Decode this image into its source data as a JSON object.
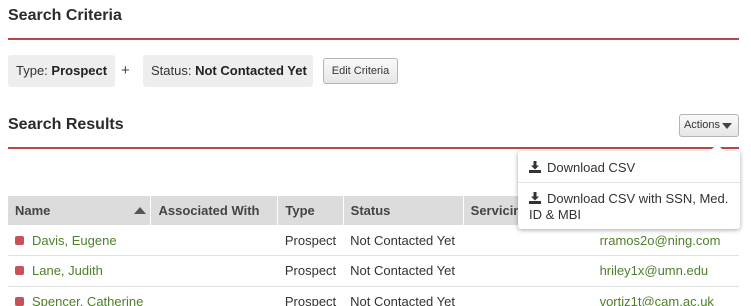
{
  "criteria": {
    "title": "Search Criteria",
    "type_label": "Type:",
    "type_value": "Prospect",
    "plus": "+",
    "status_label": "Status:",
    "status_value": "Not Contacted Yet",
    "edit_button": "Edit Criteria"
  },
  "results": {
    "title": "Search Results",
    "actions_button": "Actions"
  },
  "dropdown": {
    "items": [
      {
        "label": "Download CSV",
        "icon": "download-icon"
      },
      {
        "label": "Download CSV with SSN, Med. ID & MBI",
        "icon": "download-icon"
      }
    ]
  },
  "table": {
    "headers": [
      "Name",
      "Associated With",
      "Type",
      "Status",
      "Servicing",
      ""
    ],
    "sorted_column": "Name",
    "sort_direction": "ascending",
    "rows": [
      {
        "name": "Davis, Eugene",
        "associated_with": "",
        "type": "Prospect",
        "status": "Not Contacted Yet",
        "servicing": "",
        "email": "rramos2o@ning.com"
      },
      {
        "name": "Lane, Judith",
        "associated_with": "",
        "type": "Prospect",
        "status": "Not Contacted Yet",
        "servicing": "",
        "email": "hriley1x@umn.edu"
      },
      {
        "name": "Spencer, Catherine",
        "associated_with": "",
        "type": "Prospect",
        "status": "Not Contacted Yet",
        "servicing": "",
        "email": "vortiz1t@cam.ac.uk"
      }
    ]
  },
  "colors": {
    "accent_rule": "#b8484c",
    "link": "#4f7f2b",
    "row_marker": "#c8525a",
    "header_bg": "#dcdcdc"
  }
}
